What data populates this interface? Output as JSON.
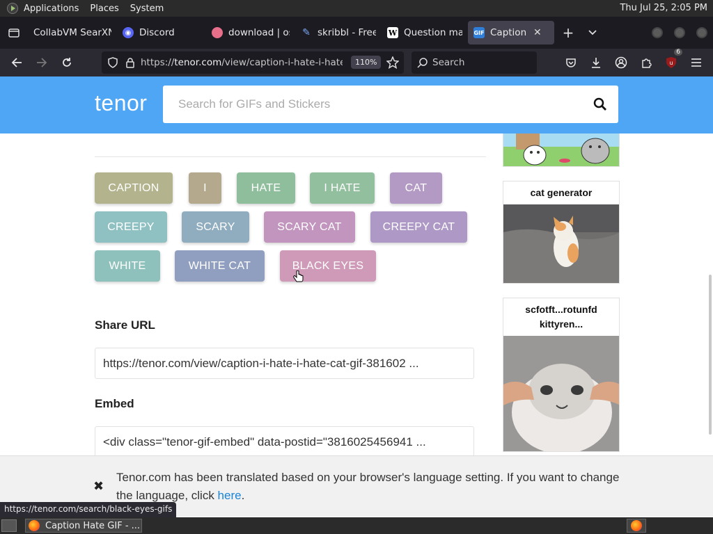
{
  "system": {
    "menus": [
      "Applications",
      "Places",
      "System"
    ],
    "clock": "Thu Jul 25,  2:05 PM"
  },
  "tabs": [
    {
      "title": "CollabVM SearXNG",
      "color": "#1c1b22"
    },
    {
      "title": "Discord",
      "color": "#5865f2"
    },
    {
      "title": "download | os",
      "color": "#e86f8a"
    },
    {
      "title": "skribbl - Free",
      "color": "#2d6bd6"
    },
    {
      "title": "Question mar",
      "color": "#ffffff"
    },
    {
      "title": "Caption Hate",
      "color": "#2f7fd9",
      "active": true
    }
  ],
  "nav": {
    "url_scheme": "https://",
    "url_host": "tenor.com",
    "url_path": "/view/caption-i-hate-i-hate-",
    "zoom": "110%",
    "search_placeholder": "Search",
    "extension_badge": "6"
  },
  "tenor": {
    "logo": "tenor",
    "search_placeholder": "Search for GIFs and Stickers"
  },
  "tags": [
    {
      "label": "CAPTION",
      "color": "#b3b48e"
    },
    {
      "label": "I",
      "color": "#b5a98d"
    },
    {
      "label": "HATE",
      "color": "#8fbe9c"
    },
    {
      "label": "I HATE",
      "color": "#92bf9e"
    },
    {
      "label": "CAT",
      "color": "#b39ac4"
    },
    {
      "label": "CREEPY",
      "color": "#8fc0c2"
    },
    {
      "label": "SCARY",
      "color": "#8fadbf"
    },
    {
      "label": "SCARY CAT",
      "color": "#c195bd"
    },
    {
      "label": "CREEPY CAT",
      "color": "#ad98c6"
    },
    {
      "label": "WHITE",
      "color": "#8fc1bc"
    },
    {
      "label": "WHITE CAT",
      "color": "#909fbf"
    },
    {
      "label": "BLACK EYES",
      "color": "#cf9ab7"
    }
  ],
  "share": {
    "label": "Share URL",
    "value": "https://tenor.com/view/caption-i-hate-i-hate-cat-gif-381602 ..."
  },
  "embed": {
    "label": "Embed",
    "value": "<div class=\"tenor-gif-embed\" data-postid=\"3816025456941 ..."
  },
  "sidebar": {
    "cards": [
      {
        "caption": "cat generator"
      },
      {
        "caption": "scfotft...rotunfd kittyren..."
      }
    ]
  },
  "notice": {
    "text": "Tenor.com has been translated based on your browser's language setting. If you want to change the language, click ",
    "link": "here",
    "end": "."
  },
  "status_url": "https://tenor.com/search/black-eyes-gifs",
  "taskbar": {
    "window_title": "Caption Hate GIF - ..."
  }
}
